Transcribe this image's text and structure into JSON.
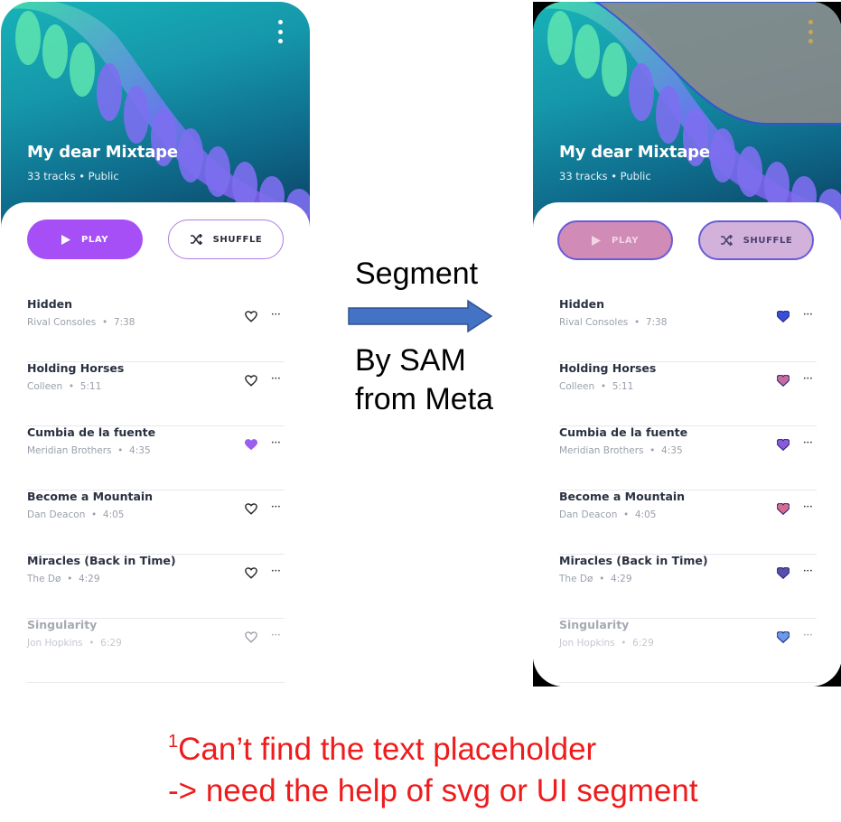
{
  "playlist": {
    "title": "My dear Mixtape",
    "subtitle": "33 tracks • Public"
  },
  "actions": {
    "play_label": "PLAY",
    "shuffle_label": "SHUFFLE"
  },
  "tracks": [
    {
      "title": "Hidden",
      "artist": "Rival Consoles",
      "duration": "7:38",
      "liked": false
    },
    {
      "title": "Holding Horses",
      "artist": "Colleen",
      "duration": "5:11",
      "liked": false
    },
    {
      "title": "Cumbia de la fuente",
      "artist": "Meridian Brothers",
      "duration": "4:35",
      "liked": true
    },
    {
      "title": "Become a Mountain",
      "artist": "Dan Deacon",
      "duration": "4:05",
      "liked": false
    },
    {
      "title": "Miracles (Back in Time)",
      "artist": "The Dø",
      "duration": "4:29",
      "liked": false
    },
    {
      "title": "Singularity",
      "artist": "Jon Hopkins",
      "duration": "6:29",
      "liked": false
    }
  ],
  "annotation": {
    "step": "Segment",
    "by_line1": "By SAM",
    "by_line2": "from Meta"
  },
  "footnote": {
    "marker": "1",
    "line1": "Can’t find the text placeholder",
    "line2": "-> need the help of svg or UI segment"
  },
  "colors": {
    "accent": "#a64ff6",
    "liked_heart": "#9b5cf0",
    "footnote": "#ee1c1c",
    "arrow_fill": "#4472c4"
  },
  "icons": {
    "menu": "more-vert-icon",
    "play": "play-icon",
    "shuffle": "shuffle-icon",
    "like": "heart-icon",
    "more": "more-horiz-icon"
  }
}
